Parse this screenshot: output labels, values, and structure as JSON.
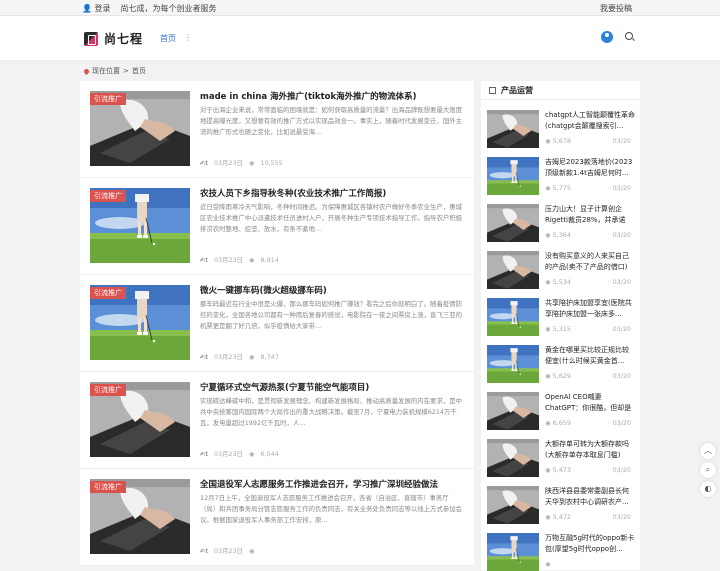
{
  "topbar": {
    "login": "登录",
    "slogan": "尚七成，为每个创业者服务",
    "submit": "我要投稿"
  },
  "header": {
    "logo": "尚七程",
    "nav_home": "首页",
    "nav_more": "⋮"
  },
  "breadcrumb": {
    "label": "现在位置",
    "sep": ">",
    "home": "首页"
  },
  "posts": [
    {
      "tag": "引流推广",
      "title": "made in china 海外推广(tiktok海外推广的物流体系)",
      "desc": "对于出海企业来说，常常面临的困境就是：如何获取高质量的流量？出海品牌既想要最大限度地提高曝光度，又想要有效的推广方式以实现品效合一。事实上，随着时代发展变迁，国外主流的推广形式也随之变化，比如说最受海...",
      "author": "t",
      "date": "03月23日",
      "views": "10,555",
      "scene": "desk"
    },
    {
      "tag": "引流推广",
      "title": "农技人员下乡指导秋冬种(农业技术推广工作简报)",
      "desc": "近日受降雨寒冷天气影响，冬种时间推迟。为保障惠城区各镇村农户做好冬季农业生产，惠城区农业技术推广中心派遣技术任员进村入户，开展冬种生产专项技术指导工作，指导农户积极排涝农时整地、挖垄、放水，有条不紊地...",
      "author": "t",
      "date": "03月23日",
      "views": "8,914",
      "scene": "golf"
    },
    {
      "tag": "引流推广",
      "title": "微火一键挪车码(微火超级挪车码)",
      "desc": "挪车码最近在行业中很是火爆，那么挪车码如何推广赚钱？看完之后你就明白了。随着疫情防控的变化，全国各地公司都有一种雨后复春的感觉，电影院在一夜之间票房上涨，直飞三亚的机票更是翻了好几倍，似乎疫情给大家带...",
      "author": "t",
      "date": "03月23日",
      "views": "8,747",
      "scene": "golf"
    },
    {
      "tag": "引流推广",
      "title": "宁夏循环式空气源热泵(宁夏节能空气能项目)",
      "desc": "实现碳达峰碳中和，是贯彻新发展理念、构建新发展格局、推动高质量发展的内在要求，是中共中央统筹国内国际两个大局作出的重大战略决策。截至7月，宁夏电力装机规模6214万千瓦，发电量超过1992亿千瓦时，人...",
      "author": "t",
      "date": "03月23日",
      "views": "6,544",
      "scene": "desk"
    },
    {
      "tag": "引流推广",
      "title": "全国退役军人志愿服务工作推进会召开，学习推广深圳经验做法",
      "desc": "12月7日上午，全国退役军人志愿服务工作推进会召开，各省（自治区、直辖市）事务厅（局）和兵团事务局分管志愿服务工作的负责同志、有关业务处负责同志等以线上方式参加会议。根据国家退役军人事务部工作安排，原...",
      "author": "t",
      "date": "03月23日",
      "views": "",
      "scene": "desk"
    }
  ],
  "sidebar": {
    "title": "产品运营",
    "items": [
      {
        "title": "chatgpt人工智能颠覆性革命(chatgpt会颠覆搜索引...",
        "views": "5,678",
        "date": "03/20",
        "scene": "desk"
      },
      {
        "title": "吉姆尼2023款落地价(2023顶级新款1.4t吉姆尼何时...",
        "views": "5,775",
        "date": "03/20",
        "scene": "golf"
      },
      {
        "title": "压力山大！显子计算创企Rigetti裁员28%，并承诺尽...",
        "views": "5,364",
        "date": "03/20",
        "scene": "desk"
      },
      {
        "title": "没有购买意义的人来买自己的产品(卖不了产品的借口)",
        "views": "5,534",
        "date": "03/20",
        "scene": "desk"
      },
      {
        "title": "共享陪护床加盟享宜(医院共享陪护床加盟一张床多...",
        "views": "5,315",
        "date": "03/20",
        "scene": "golf"
      },
      {
        "title": "黄金在哪里买比较正规比较便宜(什么时候买黄金首...",
        "views": "5,629",
        "date": "03/20",
        "scene": "golf"
      },
      {
        "title": "OpenAI CEO喊妻ChatGPT：你很酷，但却是个\"糟...",
        "views": "6,659",
        "date": "03/20",
        "scene": "desk"
      },
      {
        "title": "大额存单可转为大额存款吗(大额存单存本取息门槛)",
        "views": "5,473",
        "date": "03/20",
        "scene": "desk"
      },
      {
        "title": "陕西洋县县委常委副县长何天华到农村中心调研农产...",
        "views": "5,472",
        "date": "03/20",
        "scene": "desk"
      },
      {
        "title": "万物互融5g时代的oppo新卡包(厚望5g时代oppo创...",
        "views": "",
        "date": "",
        "scene": "golf"
      }
    ]
  },
  "float_buttons": {
    "moon": "◐"
  }
}
